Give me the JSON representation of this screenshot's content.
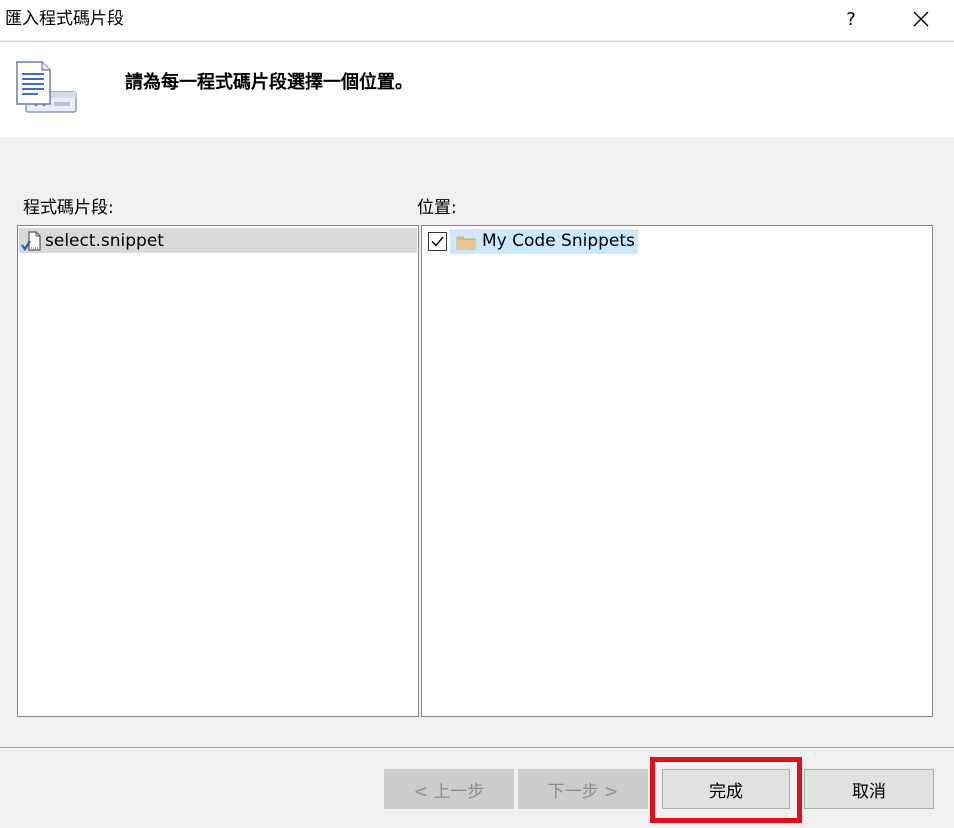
{
  "window": {
    "title": "匯入程式碼片段",
    "help_label": "?",
    "close_icon": "close-icon"
  },
  "header": {
    "icon": "document-server-icon",
    "instruction": "請為每一程式碼片段選擇一個位置。"
  },
  "snippets_panel": {
    "label": "程式碼片段:",
    "items": [
      {
        "name": "select.snippet",
        "icon": "snippet-check-icon",
        "selected": true
      }
    ]
  },
  "location_panel": {
    "label": "位置:",
    "items": [
      {
        "name": "My Code Snippets",
        "icon": "folder-icon",
        "checked": true
      }
    ]
  },
  "buttons": {
    "prev": "< 上一步",
    "next": "下一步 >",
    "finish": "完成",
    "cancel": "取消"
  },
  "colors": {
    "selection_gray": "#d9d9d9",
    "selection_blue": "#cce8ff",
    "annotation_red": "#e0101a",
    "disabled_button": "#cccccc"
  }
}
